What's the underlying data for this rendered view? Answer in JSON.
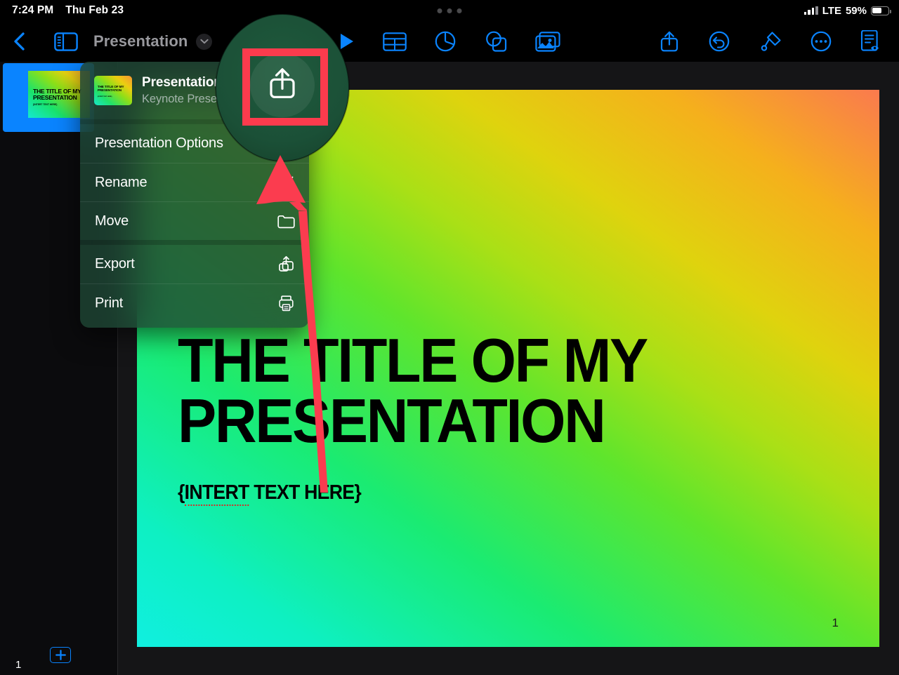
{
  "status_bar": {
    "time": "7:24 PM",
    "date": "Thu Feb 23",
    "carrier": "LTE",
    "battery_percent": "59%"
  },
  "toolbar": {
    "back_icon": "chevron-left-icon",
    "sidebar_toggle_icon": "sidebar-icon",
    "document_title": "Presentation",
    "title_chevron_icon": "chevron-down-icon",
    "items": [
      {
        "name": "play-button",
        "icon": "play-icon"
      },
      {
        "name": "insert-table-button",
        "icon": "table-icon"
      },
      {
        "name": "insert-chart-button",
        "icon": "pie-chart-icon"
      },
      {
        "name": "insert-shape-button",
        "icon": "shapes-icon"
      },
      {
        "name": "insert-media-button",
        "icon": "media-image-icon"
      },
      {
        "name": "share-button",
        "icon": "share-icon"
      },
      {
        "name": "undo-button",
        "icon": "undo-icon"
      },
      {
        "name": "format-button",
        "icon": "paintbrush-icon"
      },
      {
        "name": "more-options-button",
        "icon": "ellipsis-circle-icon"
      },
      {
        "name": "document-view-button",
        "icon": "document-eye-icon"
      }
    ]
  },
  "sidebar": {
    "slide_number": "1",
    "thumbnail_title": "THE TITLE OF MY PRESENTATION",
    "thumbnail_subtitle": "{INTERT TEXT HERE}",
    "add_slide_label": "+"
  },
  "slide": {
    "title": "THE TITLE OF MY PRESENTATION",
    "subtitle_misspelled": "INTERT",
    "subtitle_rest": " TEXT HERE}",
    "subtitle_open_brace": "{",
    "page_number": "1"
  },
  "popover": {
    "document_name": "Presentation",
    "document_subtitle": "Keynote Prese…n…",
    "items": [
      {
        "label": "Presentation Options",
        "icon": "none",
        "name": "menu-item-presentation-options"
      },
      {
        "label": "Rename",
        "icon": "pencil-icon",
        "name": "menu-item-rename"
      },
      {
        "label": "Move",
        "icon": "folder-icon",
        "name": "menu-item-move"
      },
      {
        "label": "Export",
        "icon": "export-share-icon",
        "name": "menu-item-export"
      },
      {
        "label": "Print",
        "icon": "printer-icon",
        "name": "menu-item-print"
      }
    ]
  },
  "annotation": {
    "magnifier_icon": "share-icon",
    "highlight_color": "#fc3b4d",
    "arrow_color": "#fb3c4f"
  },
  "colors": {
    "accent_blue": "#0a84ff",
    "highlight_red": "#fc3b4d",
    "slide_gradient_start": "#10efe0",
    "slide_gradient_end": "#fa7a4e",
    "popover_background": "#1e4634"
  }
}
